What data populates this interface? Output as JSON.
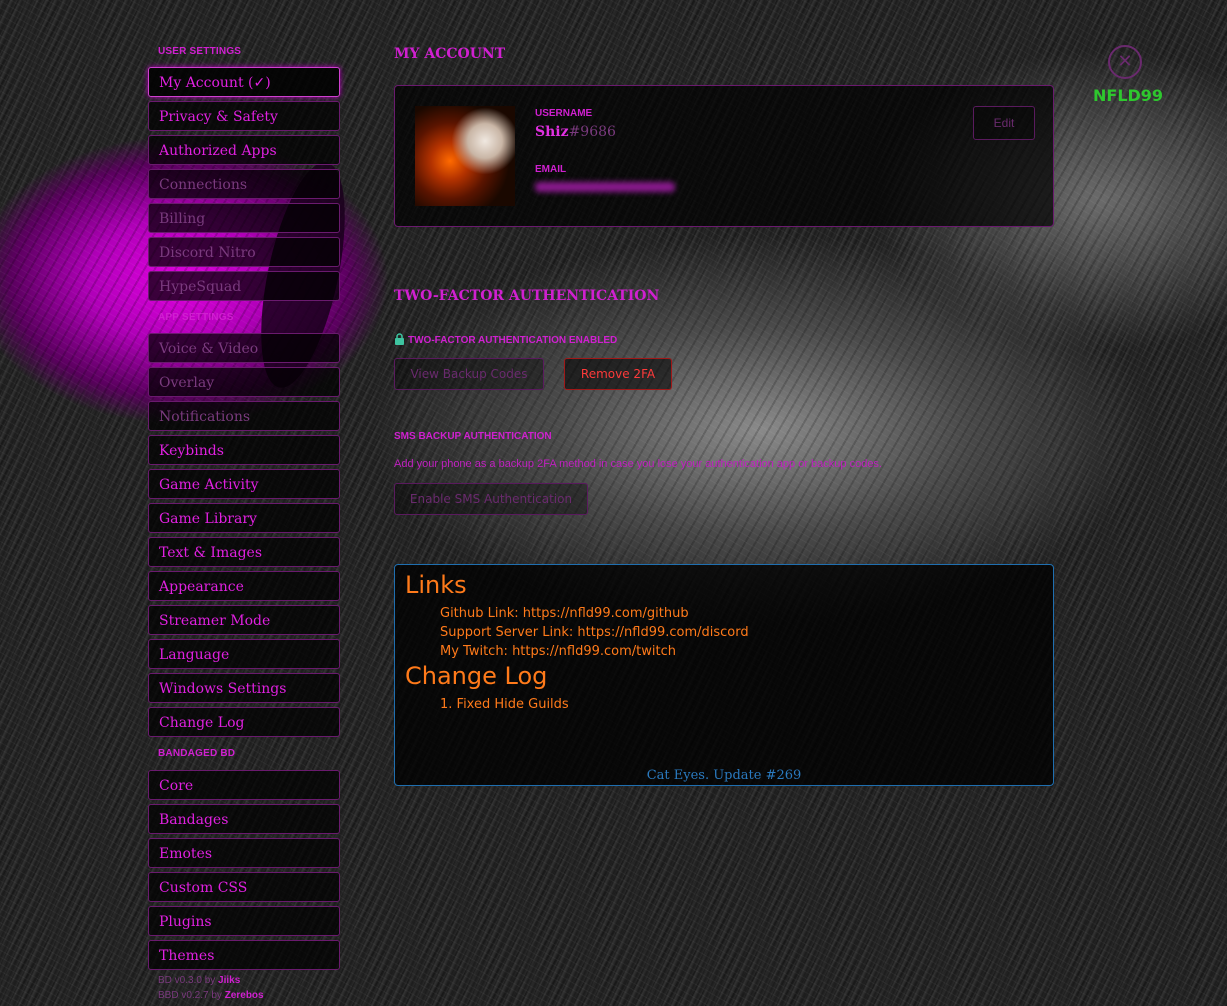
{
  "sidebar": {
    "sections": [
      {
        "title": "USER SETTINGS",
        "items": [
          "My Account (✓)",
          "Privacy & Safety",
          "Authorized Apps",
          "Connections",
          "Billing",
          "Discord Nitro",
          "HypeSquad"
        ]
      },
      {
        "title": "APP SETTINGS",
        "items": [
          "Voice & Video",
          "Overlay",
          "Notifications",
          "Keybinds",
          "Game Activity",
          "Game Library",
          "Text & Images",
          "Appearance",
          "Streamer Mode",
          "Language",
          "Windows Settings",
          "Change Log"
        ]
      },
      {
        "title": "BANDAGED BD",
        "items": [
          "Core",
          "Bandages",
          "Emotes",
          "Custom CSS",
          "Plugins",
          "Themes"
        ]
      }
    ],
    "footer": [
      {
        "prefix": "BD v0.3.0 by ",
        "author": "Jiiks"
      },
      {
        "prefix": "BBD v0.2.7 by ",
        "author": "Zerebos"
      }
    ]
  },
  "account": {
    "title": "MY ACCOUNT",
    "username_label": "USERNAME",
    "username": "Shiz",
    "discriminator": "#9686",
    "email_label": "EMAIL",
    "edit_label": "Edit"
  },
  "twofa": {
    "title": "TWO-FACTOR AUTHENTICATION",
    "status": "TWO-FACTOR AUTHENTICATION ENABLED",
    "view_backup_label": "View Backup Codes",
    "remove_label": "Remove 2FA",
    "sms_title": "SMS BACKUP AUTHENTICATION",
    "sms_desc": "Add your phone as a backup 2FA method in case you lose your authentication app or backup codes.",
    "sms_button": "Enable SMS Authentication"
  },
  "info": {
    "links_title": "Links",
    "links": [
      "Github Link: https://nfld99.com/github",
      "Support Server Link: https://nfld99.com/discord",
      "My Twitch: https://nfld99.com/twitch"
    ],
    "changelog_title": "Change Log",
    "changelog": [
      "1. Fixed Hide Guilds"
    ],
    "footer": "Cat Eyes. Update #269"
  },
  "close": {
    "label": "NFLD99"
  },
  "colors": {
    "accent": "#d020d0",
    "danger": "#ff3a3a",
    "info": "#ff7a1a",
    "link_blue": "#2a7ac0",
    "close_green": "#2ec82e"
  }
}
